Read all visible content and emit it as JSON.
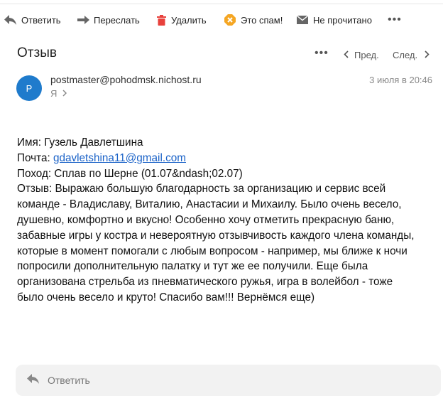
{
  "toolbar": {
    "reply": "Ответить",
    "forward": "Переслать",
    "delete": "Удалить",
    "spam": "Это спам!",
    "unread": "Не прочитано",
    "more": "•••"
  },
  "message": {
    "subject": "Отзыв",
    "more": "•••",
    "prev": "Пред.",
    "next": "След.",
    "avatar_letter": "P",
    "sender": "postmaster@pohodmsk.nichost.ru",
    "recipient": "Я",
    "date": "3 июля в 20:46"
  },
  "body": {
    "name_line": "Имя: Гузель Давлетшина",
    "email_prefix": "Почта: ",
    "email": "gdavletshina11@gmail.com",
    "trip_line": "Поход: Сплав по Шерне (01.07&ndash;02.07)",
    "review_lines": [
      "Отзыв: Выражаю большую благодарность за организацию и сервис всей",
      "команде - Владиславу, Виталию, Анастасии и Михаилу. Было очень весело,",
      "душевно, комфортно и вкусно! Особенно хочу отметить прекрасную баню,",
      "забавные игры у костра и невероятную отзывчивость каждого члена команды,",
      "которые в момент помогали с любым вопросом - например, мы ближе к ночи",
      "попросили дополнительную палатку и тут же ее получили. Еще была",
      "организована стрельба из пневматического ружья, игра в волейбол - тоже",
      "было очень весело и круто! Спасибо вам!!! Вернёмся еще)"
    ]
  },
  "reply_box": {
    "label": "Ответить"
  },
  "colors": {
    "avatar": "#1f7bcc",
    "link": "#1a62c8",
    "delete_icon": "#e8413c",
    "spam_icon": "#f5a623"
  }
}
